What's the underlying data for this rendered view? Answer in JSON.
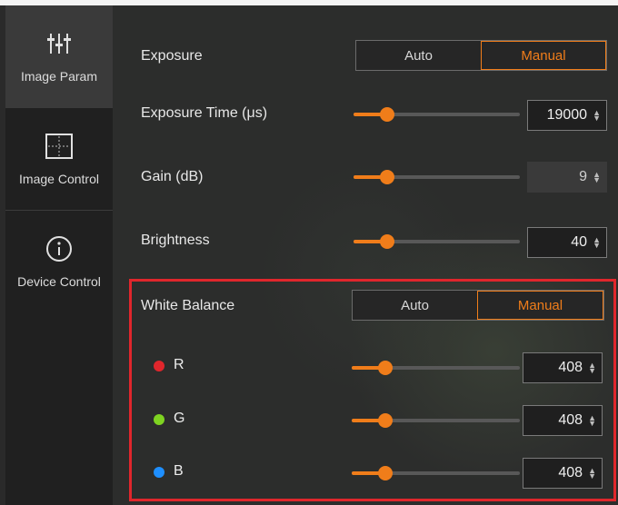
{
  "sidebar": {
    "items": [
      {
        "label": "Image Param",
        "icon": "sliders-icon",
        "active": true
      },
      {
        "label": "Image Control",
        "icon": "crosshair-frame-icon",
        "active": false
      },
      {
        "label": "Device Control",
        "icon": "info-icon",
        "active": false
      }
    ]
  },
  "exposure": {
    "label": "Exposure",
    "auto_label": "Auto",
    "manual_label": "Manual",
    "selected": "Manual"
  },
  "exposure_time": {
    "label": "Exposure Time (μs)",
    "value": "19000",
    "level": 0.2
  },
  "gain": {
    "label": "Gain (dB)",
    "value": "9",
    "level": 0.2
  },
  "brightness": {
    "label": "Brightness",
    "value": "40",
    "level": 0.2
  },
  "white_balance": {
    "label": "White Balance",
    "auto_label": "Auto",
    "manual_label": "Manual",
    "selected": "Manual",
    "channels": [
      {
        "label": "R",
        "value": "408",
        "color": "#e0262c",
        "level": 0.2
      },
      {
        "label": "G",
        "value": "408",
        "color": "#7ed321",
        "level": 0.2
      },
      {
        "label": "B",
        "value": "408",
        "color": "#1e8fff",
        "level": 0.2
      }
    ]
  },
  "colors": {
    "accent": "#f07d1a",
    "highlight_border": "#e0262c"
  }
}
